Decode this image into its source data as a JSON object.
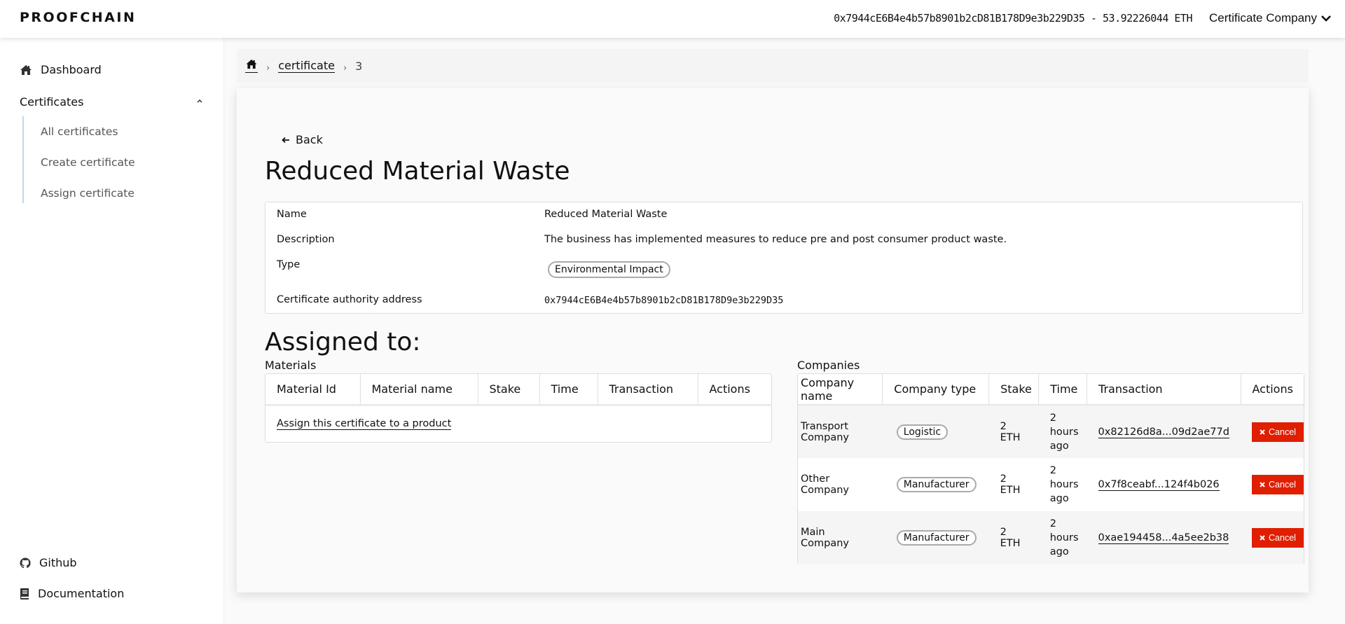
{
  "header": {
    "logo": "PROOFCHAIN",
    "wallet": "0x7944cE6B4e4b57b8901b2cD81B178D9e3b229D35 - 53.92226044 ETH",
    "account": "Certificate Company"
  },
  "sidebar": {
    "dashboard": "Dashboard",
    "certificates": "Certificates",
    "sub_items": [
      "All certificates",
      "Create certificate",
      "Assign certificate"
    ],
    "github": "Github",
    "documentation": "Documentation"
  },
  "breadcrumb": {
    "link": "certificate",
    "current": "3"
  },
  "page": {
    "back": "Back",
    "title": "Reduced Material Waste",
    "details": {
      "name_label": "Name",
      "name_value": "Reduced Material Waste",
      "description_label": "Description",
      "description_value": "The business has implemented measures to reduce pre and post consumer product waste.",
      "type_label": "Type",
      "type_value": "Environmental Impact",
      "authority_label": "Certificate authority address",
      "authority_value": "0x7944cE6B4e4b57b8901b2cD81B178D9e3b229D35"
    },
    "assigned_heading": "Assigned to:",
    "materials": {
      "label": "Materials",
      "columns": [
        "Material Id",
        "Material name",
        "Stake",
        "Time",
        "Transaction",
        "Actions"
      ],
      "empty_link": "Assign this certificate to a product"
    },
    "companies": {
      "label": "Companies",
      "columns": [
        "Company name",
        "Company type",
        "Stake",
        "Time",
        "Transaction",
        "Actions"
      ],
      "rows": [
        {
          "name": "Transport Company",
          "type": "Logistic",
          "stake": "2 ETH",
          "time": "2 hours ago",
          "tx": "0x82126d8a...09d2ae77d",
          "action": "Cancel"
        },
        {
          "name": "Other Company",
          "type": "Manufacturer",
          "stake": "2 ETH",
          "time": "2 hours ago",
          "tx": "0x7f8ceabf...124f4b026",
          "action": "Cancel"
        },
        {
          "name": "Main Company",
          "type": "Manufacturer",
          "stake": "2 ETH",
          "time": "2 hours ago",
          "tx": "0xae194458...4a5ee2b38",
          "action": "Cancel"
        }
      ]
    }
  },
  "colors": {
    "cancel": "#e01e00",
    "sidebar_accent": "#c3d4f0"
  }
}
